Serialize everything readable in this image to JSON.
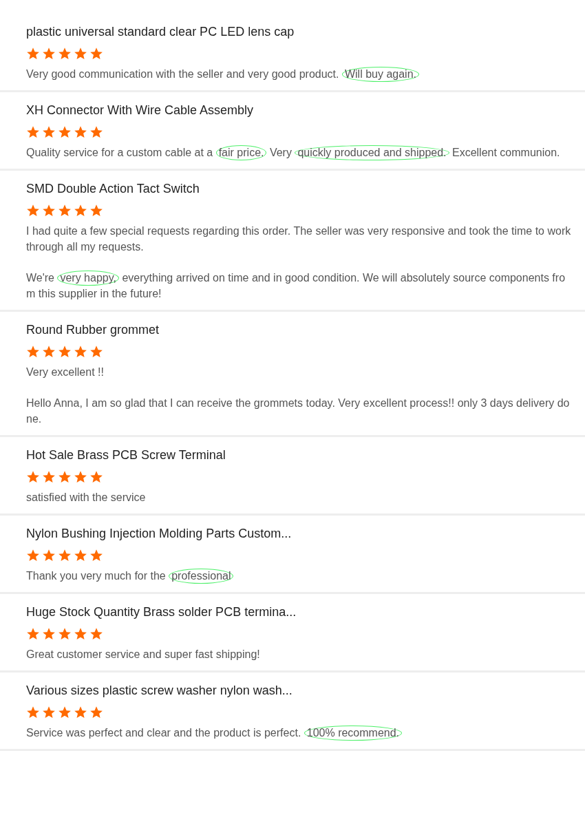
{
  "reviews": [
    {
      "title": "plastic universal standard clear PC LED lens cap",
      "stars": 5,
      "paragraphs": [
        [
          {
            "text": "Very good communication with the seller and very good product. ",
            "circled": false
          },
          {
            "text": "Will buy again.",
            "circled": true
          }
        ]
      ]
    },
    {
      "title": "XH Connector With Wire Cable Assembly",
      "stars": 5,
      "paragraphs": [
        [
          {
            "text": "Quality service for a custom cable at a ",
            "circled": false
          },
          {
            "text": "fair price.",
            "circled": true
          },
          {
            "text": " Very ",
            "circled": false
          },
          {
            "text": "quickly produced and shipped.",
            "circled": true
          },
          {
            "text": " Excellent communion.",
            "circled": false
          }
        ]
      ]
    },
    {
      "title": "SMD Double Action Tact Switch",
      "stars": 5,
      "paragraphs": [
        [
          {
            "text": "I had quite a few special requests regarding this order. The seller was very responsive and took the time to work through all my requests.",
            "circled": false
          }
        ],
        [
          {
            "text": "We're ",
            "circled": false
          },
          {
            "text": "very happy,",
            "circled": true
          },
          {
            "text": " everything arrived on time and in good condition. We will absolutely source components from this supplier in the future!",
            "circled": false
          }
        ]
      ]
    },
    {
      "title": "Round Rubber grommet",
      "stars": 5,
      "paragraphs": [
        [
          {
            "text": "Very excellent !!",
            "circled": false
          }
        ],
        [
          {
            "text": "Hello Anna, I am so glad that I can receive the grommets today. Very excellent process!! only 3 days delivery done.",
            "circled": false
          }
        ]
      ]
    },
    {
      "title": "Hot Sale Brass PCB Screw Terminal",
      "stars": 5,
      "paragraphs": [
        [
          {
            "text": "satisfied with the service",
            "circled": false
          }
        ]
      ]
    },
    {
      "title": "Nylon Bushing Injection Molding Parts Custom...",
      "stars": 5,
      "paragraphs": [
        [
          {
            "text": "Thank you very much for the ",
            "circled": false
          },
          {
            "text": "professional",
            "circled": true
          }
        ]
      ]
    },
    {
      "title": "Huge Stock Quantity Brass solder PCB termina...",
      "stars": 5,
      "paragraphs": [
        [
          {
            "text": "Great customer service and super fast shipping!",
            "circled": false
          }
        ]
      ]
    },
    {
      "title": "Various sizes plastic screw washer nylon wash...",
      "stars": 5,
      "paragraphs": [
        [
          {
            "text": "Service was perfect and clear and the product is perfect. ",
            "circled": false
          },
          {
            "text": "100% recommend.",
            "circled": true
          }
        ]
      ]
    }
  ]
}
